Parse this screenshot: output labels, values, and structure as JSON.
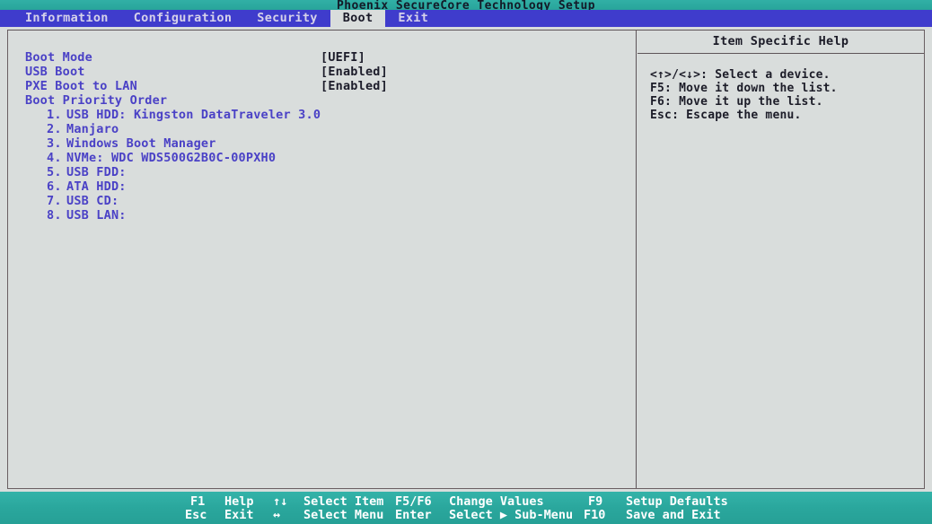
{
  "title_bar": {
    "title": "Phoenix SecureCore Technology Setup"
  },
  "menu": {
    "tabs": [
      {
        "label": "Information",
        "active": false
      },
      {
        "label": "Configuration",
        "active": false
      },
      {
        "label": "Security",
        "active": false
      },
      {
        "label": "Boot",
        "active": true
      },
      {
        "label": "Exit",
        "active": false
      }
    ]
  },
  "main": {
    "settings": [
      {
        "label": "Boot Mode",
        "value": "[UEFI]"
      },
      {
        "label": "USB Boot",
        "value": "[Enabled]"
      },
      {
        "label": "PXE Boot to LAN",
        "value": "[Enabled]"
      }
    ],
    "boot_priority": {
      "title": "Boot Priority Order",
      "items": [
        {
          "index": "1.",
          "name": "USB HDD: Kingston DataTraveler 3.0"
        },
        {
          "index": "2.",
          "name": "Manjaro"
        },
        {
          "index": "3.",
          "name": "Windows Boot Manager"
        },
        {
          "index": "4.",
          "name": "NVMe: WDC WDS500G2B0C-00PXH0"
        },
        {
          "index": "5.",
          "name": "USB FDD:"
        },
        {
          "index": "6.",
          "name": "ATA HDD:"
        },
        {
          "index": "7.",
          "name": "USB CD:"
        },
        {
          "index": "8.",
          "name": "USB LAN:"
        }
      ]
    }
  },
  "help": {
    "title": "Item Specific Help",
    "lines": [
      "<↑>/<↓>: Select a device.",
      "F5: Move it down the list.",
      "F6: Move it up the list.",
      "Esc: Escape the menu."
    ]
  },
  "status_bar": {
    "row1": [
      {
        "key": "F1",
        "desc": "Help"
      },
      {
        "key": "↑↓",
        "desc": "Select Item"
      },
      {
        "key": "F5/F6",
        "desc": "Change Values"
      },
      {
        "key": "F9",
        "desc": "Setup Defaults"
      }
    ],
    "row2": [
      {
        "key": "Esc",
        "desc": "Exit"
      },
      {
        "key": "↔",
        "desc": "Select Menu"
      },
      {
        "key": "Enter",
        "desc": "Select ▶ Sub-Menu"
      },
      {
        "key": "F10",
        "desc": "Save and Exit"
      }
    ]
  },
  "colors": {
    "title_bar_bg": "#2aa79d",
    "menu_bar_bg": "#3f3ccc",
    "content_bg": "#d9dddc",
    "label_text": "#4a41c6",
    "value_text": "#1c1c2a",
    "status_bar_bg": "#2aa79d",
    "status_text": "#ffffff",
    "active_tab_bg": "#d9dddc"
  }
}
